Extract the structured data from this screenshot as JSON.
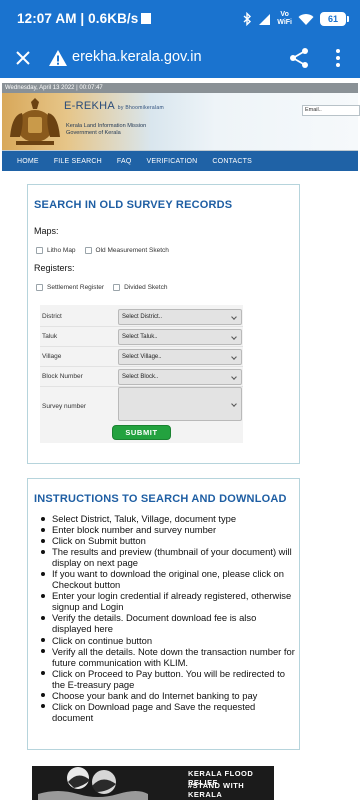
{
  "status_bar": {
    "time": "12:07 AM | 0.6KB/s",
    "network_label": "Vo\nWiFi",
    "battery": "61",
    "colors": {
      "background": "#1a73cf"
    }
  },
  "browser": {
    "url": "erekha.kerala.gov.in",
    "icons": [
      "close-icon",
      "warning-icon",
      "share-icon",
      "more-vert-icon"
    ]
  },
  "site": {
    "date_line": "Wednesday, April 13 2022 | 00:07:47",
    "brand": {
      "title": "E-REKHA",
      "by": "by Bhoomikeralam",
      "line1": "Kerala Land Information Mission",
      "line2": "Government of Kerala"
    },
    "email_placeholder": "Email..",
    "nav": [
      "HOME",
      "FILE SEARCH",
      "FAQ",
      "VERIFICATION",
      "CONTACTS"
    ]
  },
  "search": {
    "title": "SEARCH IN OLD SURVEY RECORDS",
    "maps_label": "Maps:",
    "maps_options": [
      "Litho Map",
      "Old Measurement Sketch"
    ],
    "registers_label": "Registers:",
    "registers_options": [
      "Settlement Register",
      "Divided Sketch"
    ],
    "fields": [
      {
        "label": "District",
        "value": "Select District.."
      },
      {
        "label": "Taluk",
        "value": "Select Taluk.."
      },
      {
        "label": "Village",
        "value": "Select Village.."
      },
      {
        "label": "Block Number",
        "value": "Select Block.."
      }
    ],
    "survey_label": "Survey number",
    "submit_label": "SUBMIT"
  },
  "instructions": {
    "title": "INSTRUCTIONS TO SEARCH AND DOWNLOAD",
    "items": [
      "Select District, Taluk, Village, document type",
      "Enter block number and survey number",
      "Click on Submit button",
      "The results and preview (thumbnail of your document) will display on next page",
      "If you want to download the original one, please click on Checkout button",
      "Enter your login credential if already registered, otherwise signup and Login",
      "Verify the details. Document download fee is also displayed here",
      "Click on continue button",
      "Verify all the details. Note down the transaction number for future communication with KLIM.",
      "Click on Proceed to Pay button. You will be redirected to the E-treasury page",
      "Choose your bank and do Internet banking to pay",
      "Click on Download page and Save the requested document"
    ]
  },
  "flood_banner": {
    "line1": "KERALA FLOOD RELIEF",
    "line2": "#STAND WITH KERALA"
  }
}
